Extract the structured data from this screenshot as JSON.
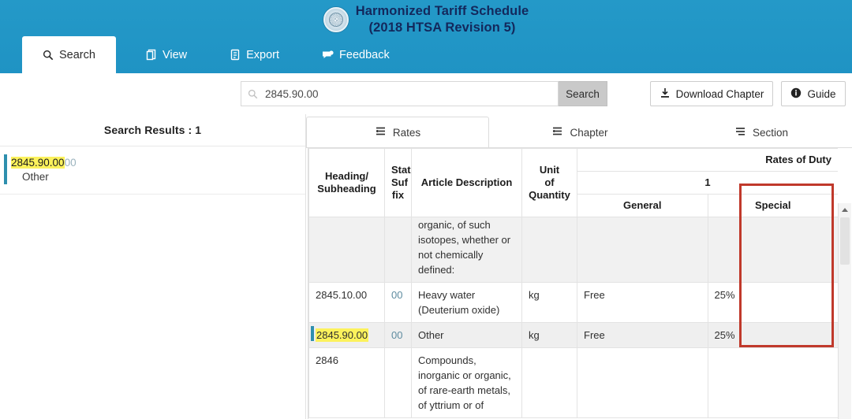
{
  "header": {
    "title_line1": "Harmonized Tariff Schedule",
    "title_line2": "(2018 HTSA Revision 5)",
    "seal_icon": "government-seal-icon",
    "tabs": [
      {
        "label": "Search",
        "icon": "search-icon",
        "active": true
      },
      {
        "label": "View",
        "icon": "document-icon",
        "active": false
      },
      {
        "label": "Export",
        "icon": "export-icon",
        "active": false
      },
      {
        "label": "Feedback",
        "icon": "feedback-icon",
        "active": false
      }
    ]
  },
  "search": {
    "value": "2845.90.00",
    "placeholder": "Search",
    "icon": "search-icon",
    "button_label": "Search",
    "download_label": "Download Chapter",
    "download_icon": "download-icon",
    "guide_label": "Guide",
    "guide_icon": "info-icon"
  },
  "results": {
    "title": "Search Results : 1",
    "items": [
      {
        "code_highlight": "2845.90.00",
        "code_tail": "00",
        "description": "Other"
      }
    ]
  },
  "subtabs": [
    {
      "label": "Rates",
      "icon": "list-icon",
      "active": true
    },
    {
      "label": "Chapter",
      "icon": "list-icon",
      "active": false
    },
    {
      "label": "Section",
      "icon": "list-icon",
      "active": false
    }
  ],
  "table": {
    "headers": {
      "heading": "Heading/",
      "subheading": "Subheading",
      "stat": "Stat",
      "suf": "Suf",
      "fix": "fix",
      "description": "Article Description",
      "unit": "Unit",
      "unit_of": "of",
      "unit_quantity": "Quantity",
      "rates_of_duty": "Rates of Duty",
      "rate_group": "1",
      "general": "General",
      "special": "Special"
    },
    "rows": [
      {
        "heading": "",
        "stat": "",
        "description": "organic, of such isotopes, whether or not chemically defined:",
        "unit": "",
        "general": "",
        "special": "",
        "style": "shade",
        "clipped_top": true
      },
      {
        "heading": "2845.10.00",
        "stat": "00",
        "description": "Heavy water (Deuterium oxide)",
        "unit": "kg",
        "general": "Free",
        "special": "25%",
        "style": "plain",
        "clipped_top": false
      },
      {
        "heading": "2845.90.00",
        "stat": "00",
        "description": "Other",
        "unit": "kg",
        "general": "Free",
        "special": "25%",
        "style": "sel",
        "selected": true,
        "clipped_top": false
      },
      {
        "heading": "2846",
        "stat": "",
        "description": "Compounds, inorganic or organic, of rare-earth metals, of yttrium or of",
        "unit": "",
        "general": "",
        "special": "",
        "style": "plain",
        "clipped_top": false
      }
    ]
  },
  "annotation": {
    "highlight_column": "Special",
    "color": "#c0392b"
  },
  "colors": {
    "header_blue": "#2095c6",
    "title_navy": "#13285c",
    "highlight_yellow": "#fcf25c",
    "accent_teal": "#2e8fae",
    "annotation_red": "#c0392b"
  }
}
